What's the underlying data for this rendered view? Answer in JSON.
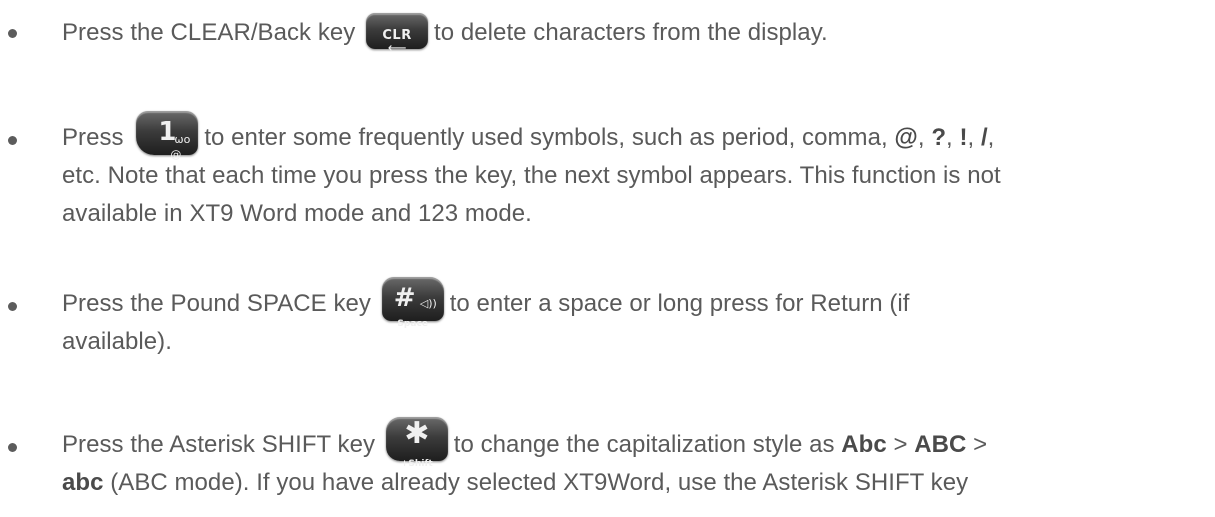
{
  "items": [
    {
      "pre": "Press the CLEAR/Back key",
      "key": {
        "icon": "clr-key-icon",
        "label": "CLR",
        "sub": "⟵"
      },
      "post": "to delete characters from the display."
    },
    {
      "pre": "Press",
      "key": {
        "icon": "one-key-icon",
        "label": "1",
        "sub": "ωo",
        "sub2": "@"
      },
      "post": "to enter some frequently used symbols, such as period, comma,",
      "sym1": "@",
      "sep1": ",",
      "sym2": "?",
      "sep2": ",",
      "sym3": "!",
      "sep3": ",",
      "sym4": "/",
      "sep4": ",",
      "line2": "etc. Note that each time you press the key, the next symbol appears. This function is not",
      "line3": "available in XT9 Word mode and 123 mode."
    },
    {
      "pre": "Press the Pound SPACE key",
      "key": {
        "icon": "pound-space-key-icon",
        "label": "#",
        "sub": "◁))",
        "sub2": "Space"
      },
      "post": "to enter a space or long press for Return (if",
      "line2": "available)."
    },
    {
      "pre": "Press the Asterisk SHIFT key",
      "key": {
        "icon": "asterisk-shift-key-icon",
        "label": "✱",
        "sub": "+Shift"
      },
      "post": "to change the capitalization style as",
      "b1": "Abc",
      "gt1": ">",
      "b2": "ABC",
      "gt2": ">",
      "line2_b": "abc",
      "line2_rest": "(ABC mode). If you have already selected XT9Word, use the Asterisk SHIFT key"
    }
  ]
}
